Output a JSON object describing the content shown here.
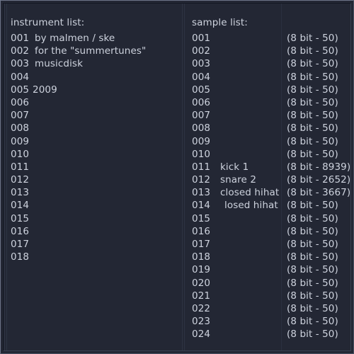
{
  "window": {
    "background_color": "#232734",
    "text_color": "#ced3de",
    "frame_highlight_color": "#6f7689",
    "frame_shadow_color": "#141722"
  },
  "instrument_panel": {
    "heading": "instrument list:",
    "rows": [
      {
        "index": "001",
        "name": "by malmen / ske"
      },
      {
        "index": "002",
        "name": "for the \"summertunes\""
      },
      {
        "index": "003",
        "name": "musicdisk"
      },
      {
        "index": "004",
        "name": ""
      },
      {
        "index": "005",
        "name": "2009"
      },
      {
        "index": "006",
        "name": ""
      },
      {
        "index": "007",
        "name": ""
      },
      {
        "index": "008",
        "name": ""
      },
      {
        "index": "009",
        "name": ""
      },
      {
        "index": "010",
        "name": ""
      },
      {
        "index": "011",
        "name": ""
      },
      {
        "index": "012",
        "name": ""
      },
      {
        "index": "013",
        "name": ""
      },
      {
        "index": "014",
        "name": ""
      },
      {
        "index": "015",
        "name": ""
      },
      {
        "index": "016",
        "name": ""
      },
      {
        "index": "017",
        "name": ""
      },
      {
        "index": "018",
        "name": ""
      }
    ]
  },
  "sample_panel": {
    "heading": "sample list:",
    "rows": [
      {
        "index": "001",
        "name": "",
        "info": "(8 bit - 50)"
      },
      {
        "index": "002",
        "name": "",
        "info": "(8 bit - 50)"
      },
      {
        "index": "003",
        "name": "",
        "info": "(8 bit - 50)"
      },
      {
        "index": "004",
        "name": "",
        "info": "(8 bit - 50)"
      },
      {
        "index": "005",
        "name": "",
        "info": "(8 bit - 50)"
      },
      {
        "index": "006",
        "name": "",
        "info": "(8 bit - 50)"
      },
      {
        "index": "007",
        "name": "",
        "info": "(8 bit - 50)"
      },
      {
        "index": "008",
        "name": "",
        "info": "(8 bit - 50)"
      },
      {
        "index": "009",
        "name": "",
        "info": "(8 bit - 50)"
      },
      {
        "index": "010",
        "name": "",
        "info": "(8 bit - 50)"
      },
      {
        "index": "011",
        "name": "kick 1",
        "info": "(8 bit - 8939)"
      },
      {
        "index": "012",
        "name": "snare 2",
        "info": "(8 bit - 2652)"
      },
      {
        "index": "013",
        "name": "closed hihat",
        "info": "(8 bit - 3667)"
      },
      {
        "index": "014",
        "name": "losed hihat",
        "info": "(8 bit - 50)",
        "indented": true
      },
      {
        "index": "015",
        "name": "",
        "info": "(8 bit - 50)"
      },
      {
        "index": "016",
        "name": "",
        "info": "(8 bit - 50)"
      },
      {
        "index": "017",
        "name": "",
        "info": "(8 bit - 50)"
      },
      {
        "index": "018",
        "name": "",
        "info": "(8 bit - 50)"
      },
      {
        "index": "019",
        "name": "",
        "info": "(8 bit - 50)"
      },
      {
        "index": "020",
        "name": "",
        "info": "(8 bit - 50)"
      },
      {
        "index": "021",
        "name": "",
        "info": "(8 bit - 50)"
      },
      {
        "index": "022",
        "name": "",
        "info": "(8 bit - 50)"
      },
      {
        "index": "023",
        "name": "",
        "info": "(8 bit - 50)"
      },
      {
        "index": "024",
        "name": "",
        "info": "(8 bit - 50)"
      }
    ]
  }
}
